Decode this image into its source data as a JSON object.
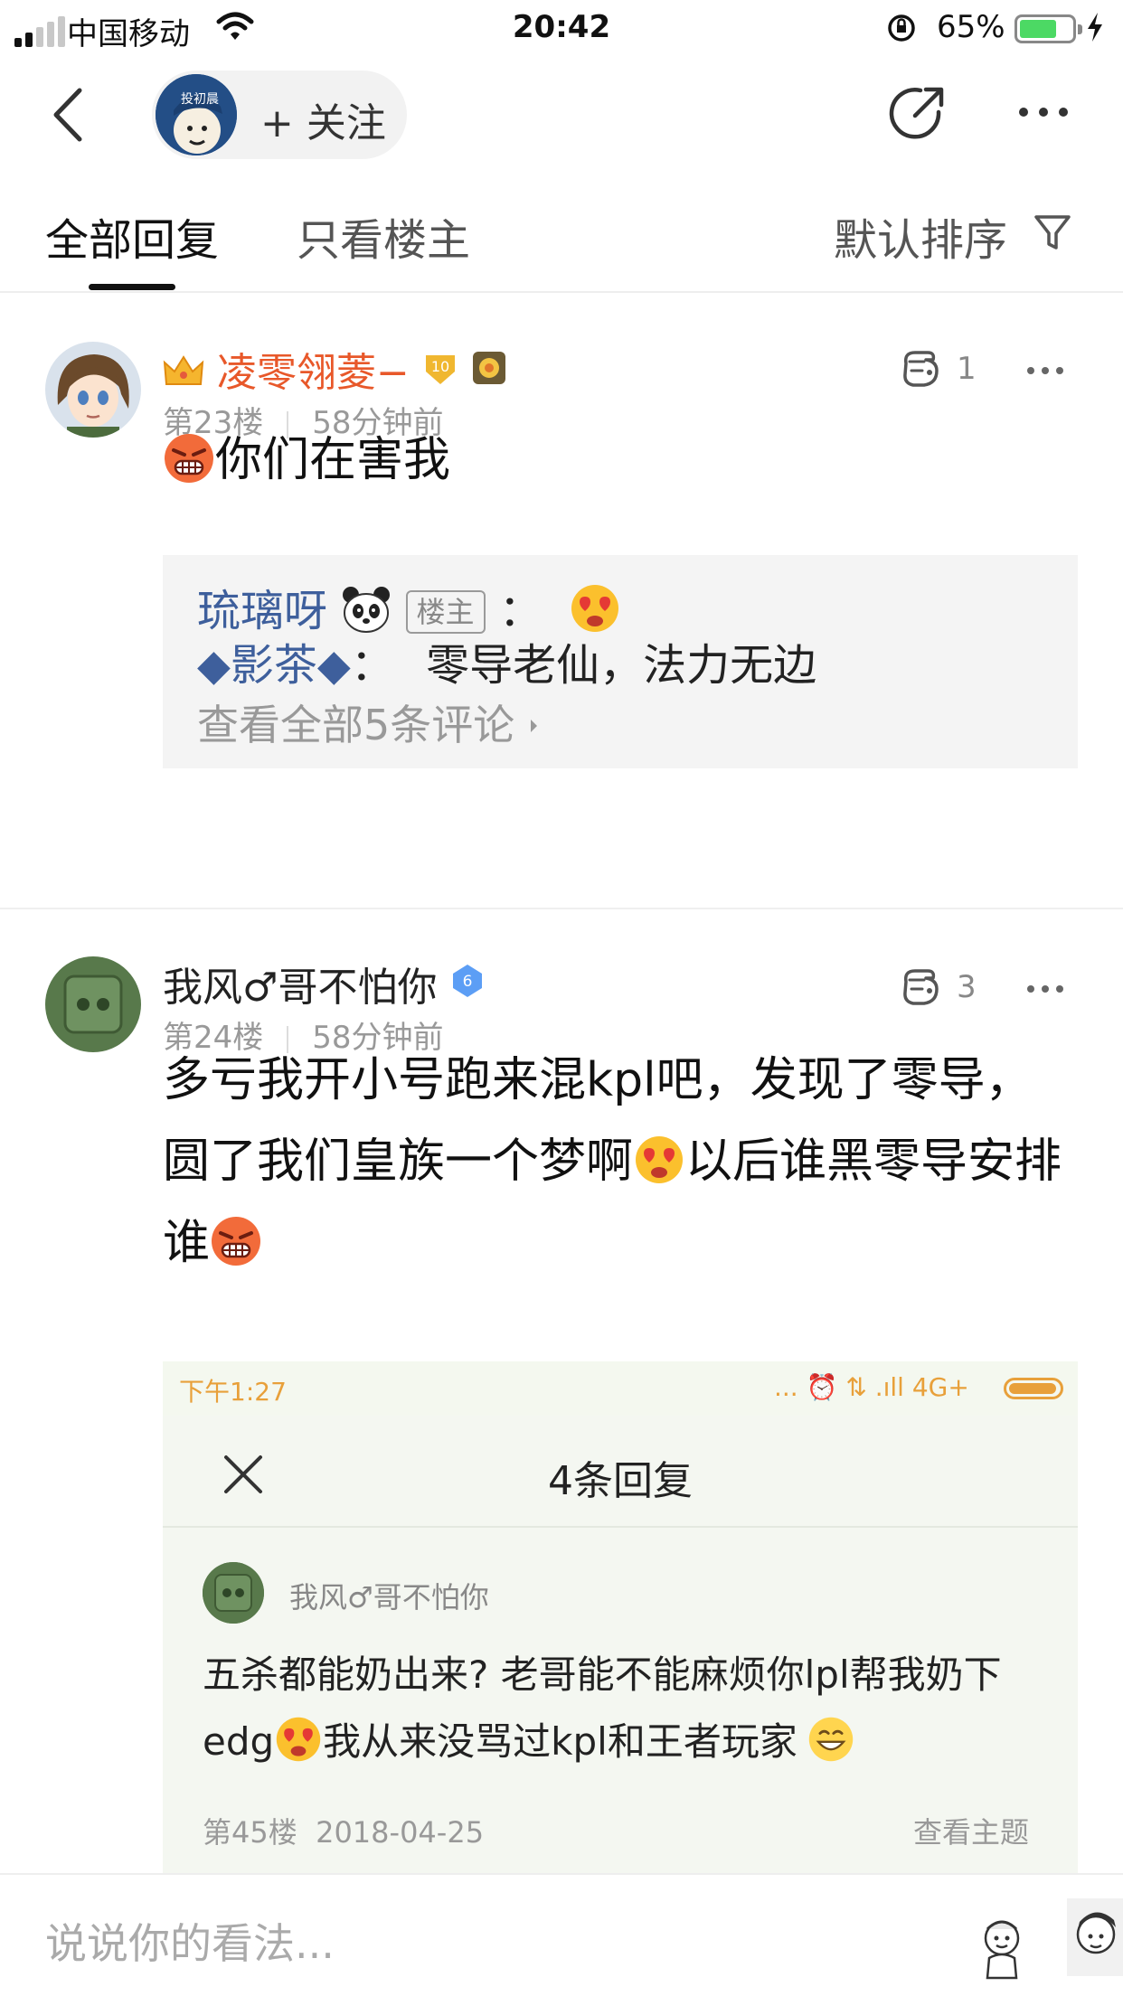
{
  "status_bar": {
    "carrier": "中国移动",
    "time": "20:42",
    "battery_percent": "65%",
    "battery_level": 0.65
  },
  "nav": {
    "follow_avatar_text": "投初晨",
    "follow_label": "+ 关注",
    "icons": [
      "back-icon",
      "share-icon",
      "more-icon"
    ]
  },
  "tabs": {
    "all": "全部回复",
    "owner_only": "只看楼主",
    "sort": "默认排序"
  },
  "comments": [
    {
      "username": "凌零翎菱−",
      "level": "10",
      "floor": "第23楼",
      "time": "58分钟前",
      "likes": "1",
      "text": "你们在害我",
      "replies": {
        "r1_user": "琉璃呀",
        "r1_tag": "楼主",
        "r1_sep": "：",
        "r2_user": "◆影茶◆",
        "r2_sep": "：",
        "r2_text": "零导老仙，法力无边",
        "view_all": "查看全部5条评论"
      }
    },
    {
      "username": "我风♂哥不怕你",
      "level": "6",
      "floor": "第24楼",
      "time": "58分钟前",
      "likes": "3",
      "text_1": "多亏我开小号跑来混kpl吧，发现了零导，圆了我们皇族一个梦啊",
      "text_2": "以后谁黑零导安排谁"
    }
  ],
  "embedded_screenshot": {
    "time": "下午1:27",
    "status_icons": "... ⏰ ⇅ .ıll 4G+",
    "title": "4条回复",
    "reply_user": "我风♂哥不怕你",
    "reply_text_1": "五杀都能奶出来? 老哥能不能麻烦你lpl帮我奶下edg",
    "reply_text_2": "我从来没骂过kpl和王者玩家",
    "floor": "第45楼",
    "date": "2018-04-25",
    "view_topic": "查看主题"
  },
  "input": {
    "placeholder": "说说你的看法..."
  },
  "colors": {
    "username_highlight": "#e8582a",
    "reply_user_blue": "#3e5f9c",
    "quote_bg": "#f4f4f4",
    "level_badge_gold": "#f0b730",
    "level_badge_blue": "#5c9ef5",
    "screenshot_accent": "#e8a03a"
  }
}
